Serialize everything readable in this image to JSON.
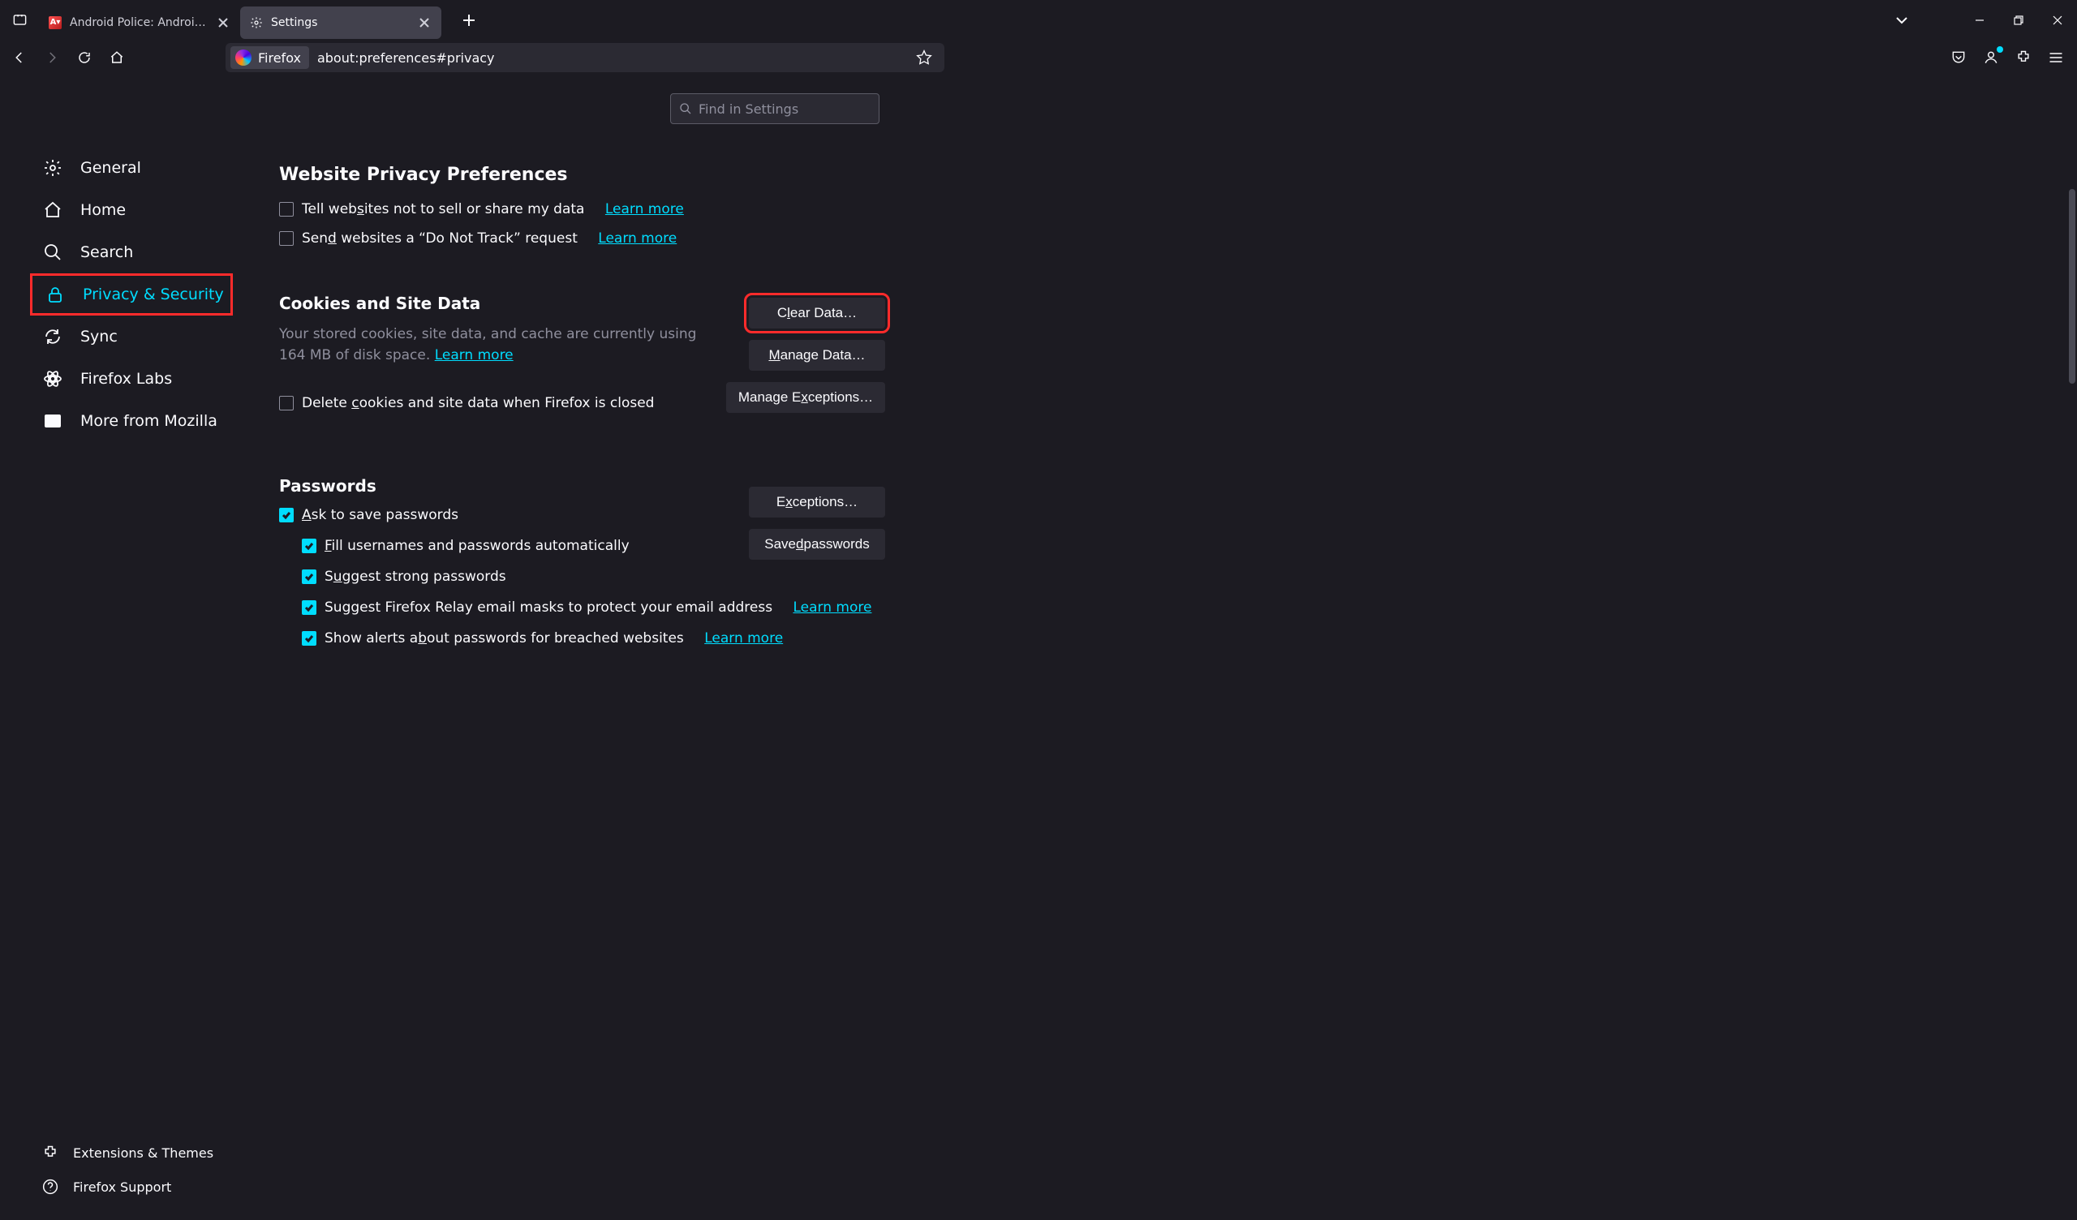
{
  "tabs": {
    "0": {
      "title": "Android Police: Android news, reviews"
    },
    "1": {
      "title": "Settings"
    }
  },
  "urlbar": {
    "identity": "Firefox",
    "url": "about:preferences#privacy"
  },
  "find_placeholder": "Find in Settings",
  "sidebar": {
    "general": "General",
    "home": "Home",
    "search": "Search",
    "privacy": "Privacy & Security",
    "sync": "Sync",
    "labs": "Firefox Labs",
    "more": "More from Mozilla",
    "ext": "Extensions & Themes",
    "support": "Firefox Support"
  },
  "sections": {
    "wpp": {
      "heading": "Website Privacy Preferences",
      "opt1": "Tell websites not to sell or share my data",
      "opt2": "Send websites a \"Do Not Track\" request",
      "learn": "Learn more"
    },
    "cookies": {
      "heading": "Cookies and Site Data",
      "desc_pre": "Your stored cookies, site data, and cache are currently using 164 MB of disk space. ",
      "learn": "Learn more",
      "delete": "Delete cookies and site data when Firefox is closed",
      "clear": "Clear Data…",
      "manage": "Manage Data…",
      "exceptions": "Manage Exceptions…"
    },
    "passwords": {
      "heading": "Passwords",
      "ask": "Ask to save passwords",
      "fill": "Fill usernames and passwords automatically",
      "suggest": "Suggest strong passwords",
      "relay": "Suggest Firefox Relay email masks to protect your email address",
      "breach": "Show alerts about passwords for breached websites",
      "learn": "Learn more",
      "exceptions": "Exceptions…",
      "saved": "Saved passwords"
    }
  }
}
